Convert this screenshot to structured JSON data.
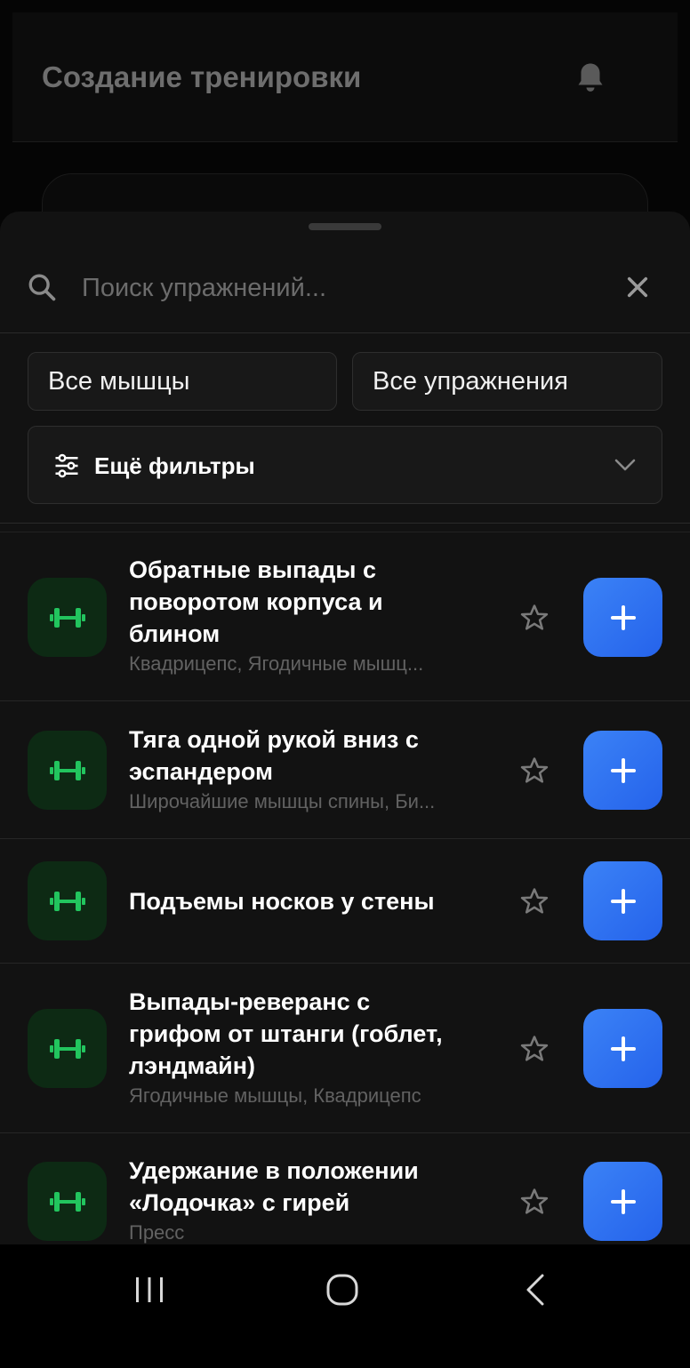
{
  "background": {
    "title": "Создание тренировки",
    "bell_icon": "bell-icon"
  },
  "search": {
    "placeholder": "Поиск упражнений...",
    "value": "",
    "search_icon": "search-icon",
    "clear_icon": "close-icon"
  },
  "filters": {
    "muscles": "Все мышцы",
    "exercises": "Все упражнения",
    "more": "Ещё фильтры"
  },
  "exercises": [
    {
      "name": "Обратные выпады с поворотом корпуса и блином",
      "lines": [
        "Обратные выпады с",
        "поворотом корпуса и",
        "блином"
      ],
      "muscles": "Квадрицепс, Ягодичные мышц..."
    },
    {
      "name": "Тяга одной рукой вниз с эспандером",
      "lines": [
        "Тяга одной рукой вниз с",
        "эспандером"
      ],
      "muscles": "Широчайшие мышцы спины, Би..."
    },
    {
      "name": "Подъемы носков у стены",
      "lines": [
        "Подъемы носков у стены"
      ],
      "muscles": ""
    },
    {
      "name": "Выпады-реверанс с грифом от штанги (гоблет, лэндмайн)",
      "lines": [
        "Выпады-реверанс с",
        "грифом от штанги (гоблет,",
        "лэндмайн)"
      ],
      "muscles": "Ягодичные мышцы, Квадрицепс"
    },
    {
      "name": "Удержание в положении «Лодочка» с гирей",
      "lines": [
        "Удержание в положении",
        "«Лодочка» с гирей"
      ],
      "muscles": "Пресс"
    }
  ],
  "colors": {
    "accent": "#2F6BF0",
    "icon_green": "#22C55E",
    "icon_bg": "#0D2A14"
  }
}
